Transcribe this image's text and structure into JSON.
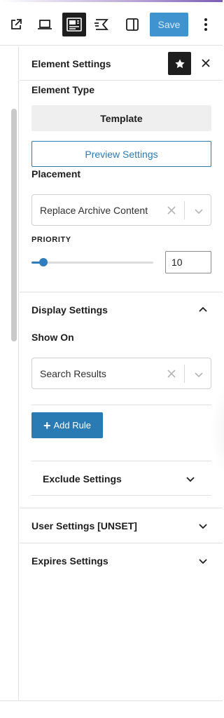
{
  "toolbar": {
    "icons": [
      "external-link-icon",
      "laptop-icon",
      "layout-template-icon",
      "motion-icon",
      "sidebar-panel-icon",
      "more-vertical-icon"
    ],
    "save_label": "Save",
    "save_color": "#3f93cf"
  },
  "panel": {
    "title": "Element Settings",
    "element_type_label": "Element Type",
    "element_type_value": "Template",
    "preview_settings_label": "Preview Settings",
    "placement_label": "Placement",
    "placement_value": "Replace Archive Content",
    "priority_label": "PRIORITY",
    "priority_value": "10",
    "priority_slider_fraction": 0.1
  },
  "display": {
    "title": "Display Settings",
    "show_on_label": "Show On",
    "show_on_value": "Search Results",
    "add_rule_label": "Add Rule",
    "exclude_title": "Exclude Settings"
  },
  "sections": {
    "user_title": "User Settings [UNSET]",
    "expires_title": "Expires Settings"
  },
  "colors": {
    "accent": "#2a7ab4",
    "dark": "#1e1e1e"
  }
}
